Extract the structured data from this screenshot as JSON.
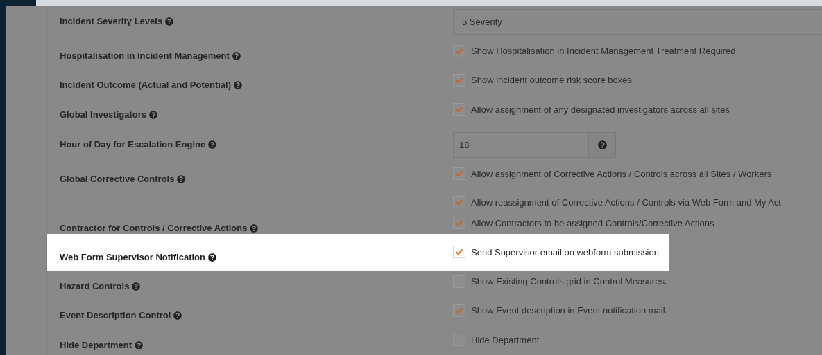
{
  "settings": [
    {
      "kind": "select",
      "label": "Incident Severity Levels",
      "value": "5 Severity",
      "highlighted": false
    },
    {
      "kind": "checks",
      "label": "Hospitalisation in Incident Management",
      "highlighted": false,
      "options": [
        {
          "label": "Show Hospitalisation in Incident Management Treatment Required",
          "checked": true
        }
      ]
    },
    {
      "kind": "checks",
      "label": "Incident Outcome (Actual and Potential)",
      "highlighted": false,
      "options": [
        {
          "label": "Show incident outcome risk score boxes",
          "checked": true
        }
      ]
    },
    {
      "kind": "checks",
      "label": "Global Investigators",
      "highlighted": false,
      "options": [
        {
          "label": "Allow assignment of any designated investigators across all sites",
          "checked": true
        }
      ]
    },
    {
      "kind": "number",
      "label": "Hour of Day for Escalation Engine",
      "value": "18",
      "highlighted": false
    },
    {
      "kind": "checks",
      "label": "Global Corrective Controls",
      "highlighted": false,
      "options": [
        {
          "label": "Allow assignment of Corrective Actions / Controls across all Sites / Workers",
          "checked": true
        },
        {
          "label": "Allow reassignment of Corrective Actions / Controls via Web Form and My Act",
          "checked": true
        }
      ]
    },
    {
      "kind": "checks",
      "label": "Contractor for Controls / Corrective Actions",
      "highlighted": false,
      "options": [
        {
          "label": "Allow Contractors to be assigned Controls/Corrective Actions",
          "checked": true
        }
      ]
    },
    {
      "kind": "checks",
      "label": "Web Form Supervisor Notification",
      "highlighted": true,
      "options": [
        {
          "label": "Send Supervisor email on webform submission",
          "checked": true
        }
      ]
    },
    {
      "kind": "checks",
      "label": "Hazard Controls",
      "highlighted": false,
      "options": [
        {
          "label": "Show Existing Controls grid in Control Measures.",
          "checked": false
        }
      ]
    },
    {
      "kind": "checks",
      "label": "Event Description Control",
      "highlighted": false,
      "options": [
        {
          "label": "Show Event description in Event notification mail.",
          "checked": true
        }
      ]
    },
    {
      "kind": "checks",
      "label": "Hide Department",
      "highlighted": false,
      "options": [
        {
          "label": "Hide Department",
          "checked": false
        }
      ]
    }
  ]
}
